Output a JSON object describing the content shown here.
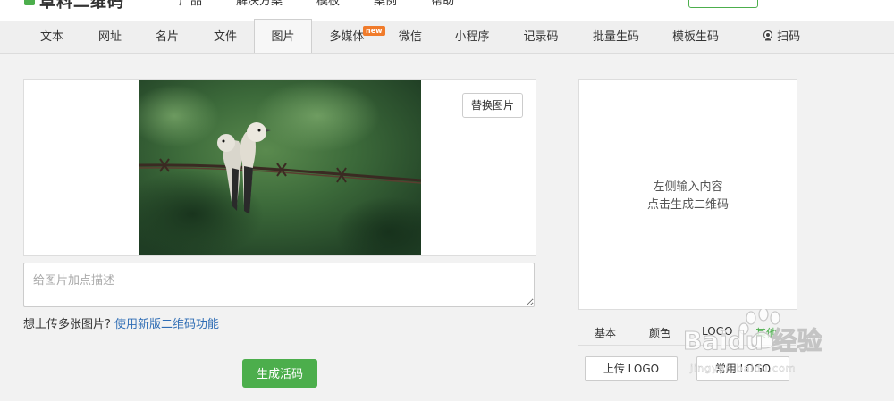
{
  "header": {
    "logo_text": "草料二维码",
    "nav": [
      "产品",
      "解决方案",
      "模板",
      "案例",
      "帮助"
    ]
  },
  "tabs": [
    {
      "label": "文本"
    },
    {
      "label": "网址"
    },
    {
      "label": "名片"
    },
    {
      "label": "文件"
    },
    {
      "label": "图片",
      "active": true
    },
    {
      "label": "多媒体",
      "badge": "new"
    },
    {
      "label": "微信"
    },
    {
      "label": "小程序"
    },
    {
      "label": "记录码"
    },
    {
      "label": "批量生码"
    },
    {
      "label": "模板生码"
    },
    {
      "label": "扫码",
      "icon": "camera-icon"
    }
  ],
  "image_panel": {
    "replace_label": "替换图片",
    "desc_placeholder": "给图片加点描述",
    "hint_text": "想上传多张图片?",
    "hint_link": "使用新版二维码功能",
    "generate_label": "生成活码"
  },
  "qr_panel": {
    "line1": "左侧输入内容",
    "line2": "点击生成二维码",
    "options": [
      "基本",
      "颜色",
      "LOGO",
      "其他"
    ],
    "upload_logo": "上传 LOGO",
    "common_logo": "常用 LOGO"
  },
  "watermark": {
    "text": "Baidu 经验",
    "url": "jingyan.baidu.com"
  },
  "colors": {
    "accent": "#4cae4c",
    "link": "#2f6db5",
    "badge": "#f07b2b"
  }
}
